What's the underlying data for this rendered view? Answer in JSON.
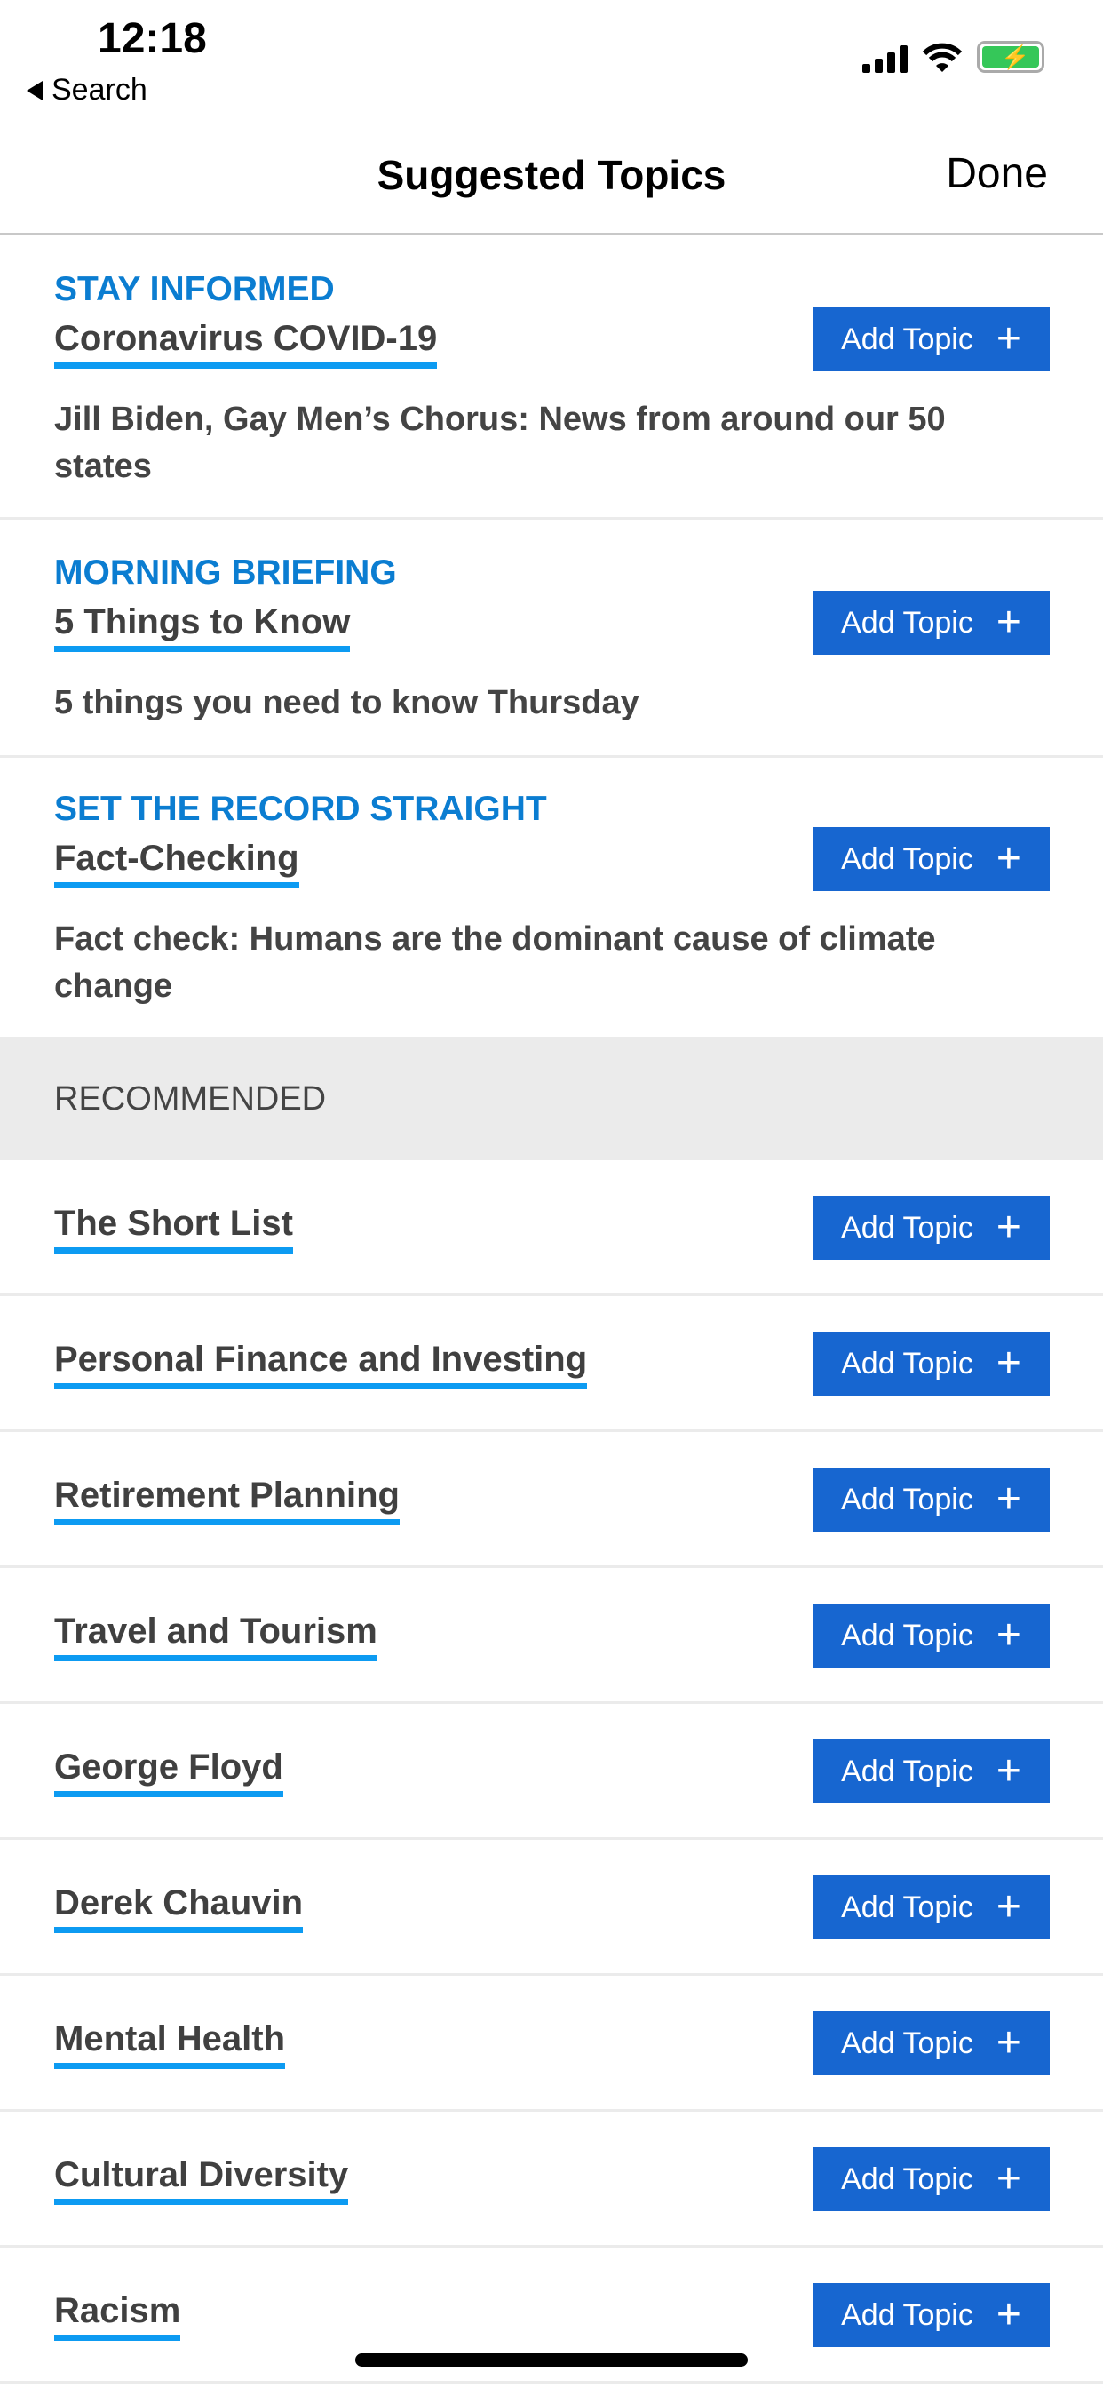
{
  "status": {
    "time": "12:18",
    "back_label": "Search"
  },
  "nav": {
    "title": "Suggested Topics",
    "done": "Done"
  },
  "button_label": "Add Topic",
  "suggested": [
    {
      "kicker": "STAY INFORMED",
      "topic": "Coronavirus COVID-19",
      "desc": "Jill Biden, Gay Men’s Chorus: News from around our 50 states"
    },
    {
      "kicker": "MORNING BRIEFING",
      "topic": "5 Things to Know",
      "desc": "5 things you need to know Thursday"
    },
    {
      "kicker": "SET THE RECORD STRAIGHT",
      "topic": "Fact-Checking",
      "desc": "Fact check: Humans are the dominant cause of climate change"
    }
  ],
  "recommended_header": "RECOMMENDED",
  "recommended": [
    "The Short List",
    "Personal Finance and Investing",
    "Retirement Planning",
    "Travel and Tourism",
    "George Floyd",
    "Derek Chauvin",
    "Mental Health",
    "Cultural Diversity",
    "Racism"
  ],
  "colors": {
    "accent": "#1766d0",
    "kicker": "#0b7dd1",
    "underline": "#0d9bf2"
  }
}
